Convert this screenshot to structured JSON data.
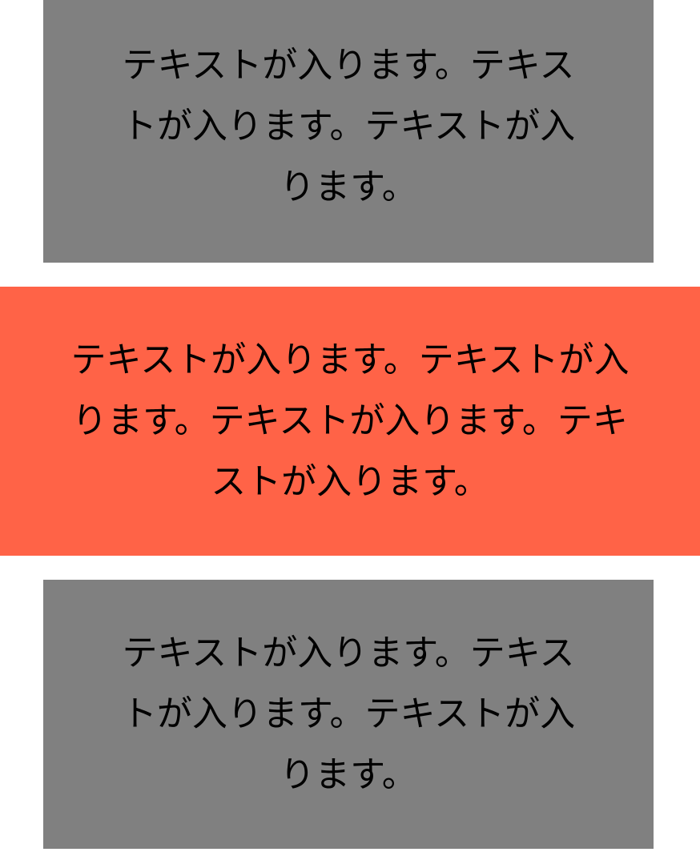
{
  "colors": {
    "background": "#ffffff",
    "gray_box": "#808080",
    "accent_box": "#ff6347",
    "text": "#000000"
  },
  "boxes": {
    "top": {
      "lines": [
        "テキストが入ります。テキス",
        "トが入ります。テキストが入",
        "ります。"
      ]
    },
    "middle": {
      "lines": [
        "テキストが入ります。テキストが入",
        "ります。テキストが入ります。テキ",
        "ストが入ります。"
      ]
    },
    "bottom": {
      "lines": [
        "テキストが入ります。テキス",
        "トが入ります。テキストが入",
        "ります。"
      ]
    }
  }
}
